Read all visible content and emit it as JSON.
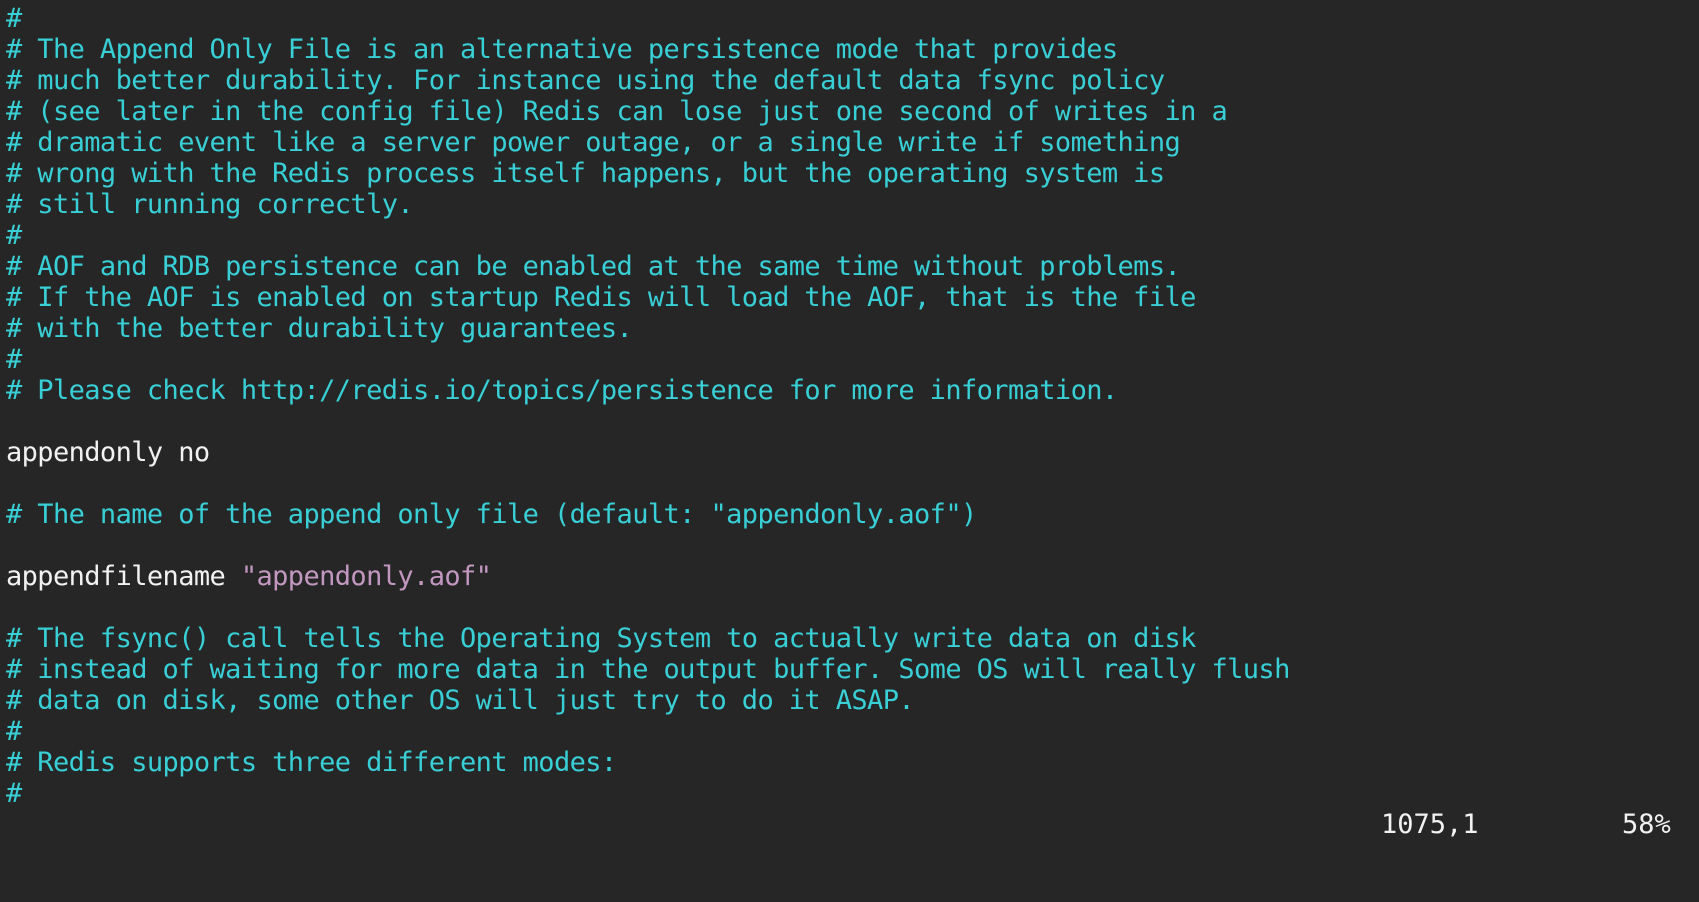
{
  "editor": {
    "lines": [
      {
        "type": "comment",
        "text": "#"
      },
      {
        "type": "comment",
        "text": "# The Append Only File is an alternative persistence mode that provides"
      },
      {
        "type": "comment",
        "text": "# much better durability. For instance using the default data fsync policy"
      },
      {
        "type": "comment",
        "text": "# (see later in the config file) Redis can lose just one second of writes in a"
      },
      {
        "type": "comment",
        "text": "# dramatic event like a server power outage, or a single write if something"
      },
      {
        "type": "comment",
        "text": "# wrong with the Redis process itself happens, but the operating system is"
      },
      {
        "type": "comment",
        "text": "# still running correctly."
      },
      {
        "type": "comment",
        "text": "#"
      },
      {
        "type": "comment",
        "text": "# AOF and RDB persistence can be enabled at the same time without problems."
      },
      {
        "type": "comment",
        "text": "# If the AOF is enabled on startup Redis will load the AOF, that is the file"
      },
      {
        "type": "comment",
        "text": "# with the better durability guarantees."
      },
      {
        "type": "comment",
        "text": "#"
      },
      {
        "type": "comment",
        "text": "# Please check http://redis.io/topics/persistence for more information."
      },
      {
        "type": "blank",
        "text": ""
      },
      {
        "type": "directive",
        "key": "appendonly",
        "value": "no"
      },
      {
        "type": "blank",
        "text": ""
      },
      {
        "type": "comment",
        "text": "# The name of the append only file (default: \"appendonly.aof\")"
      },
      {
        "type": "blank",
        "text": ""
      },
      {
        "type": "directive-string",
        "key": "appendfilename",
        "value": "\"appendonly.aof\""
      },
      {
        "type": "blank",
        "text": ""
      },
      {
        "type": "comment",
        "text": "# The fsync() call tells the Operating System to actually write data on disk"
      },
      {
        "type": "comment",
        "text": "# instead of waiting for more data in the output buffer. Some OS will really flush"
      },
      {
        "type": "comment",
        "text": "# data on disk, some other OS will just try to do it ASAP."
      },
      {
        "type": "comment",
        "text": "#"
      },
      {
        "type": "comment",
        "text": "# Redis supports three different modes:"
      },
      {
        "type": "comment",
        "text": "#"
      }
    ]
  },
  "statusline": {
    "cursor_position": "1075,1",
    "scroll_percent": "58%"
  },
  "colors": {
    "background": "#262626",
    "comment": "#38d0d6",
    "normal_text": "#f2f2f2",
    "string": "#c297c0"
  }
}
